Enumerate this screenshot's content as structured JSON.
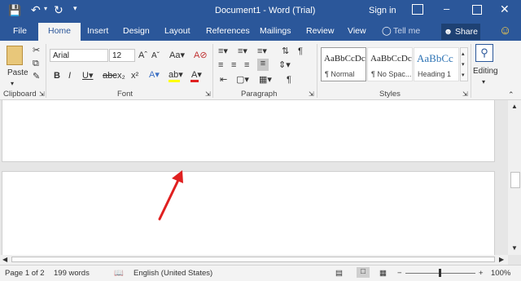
{
  "titlebar": {
    "document_title": "Document1  -  Word (Trial)",
    "signin_label": "Sign in",
    "save_icon": "save-icon",
    "undo_icon": "undo-icon",
    "redo_icon": "redo-icon"
  },
  "ribbon_tabs": [
    "File",
    "Home",
    "Insert",
    "Design",
    "Layout",
    "References",
    "Mailings",
    "Review",
    "View"
  ],
  "tell_me": "Tell me",
  "share_label": "Share",
  "clipboard": {
    "paste_label": "Paste",
    "group_label": "Clipboard"
  },
  "font": {
    "name": "Arial",
    "size": "12",
    "group_label": "Font"
  },
  "paragraph": {
    "group_label": "Paragraph"
  },
  "styles": {
    "group_label": "Styles",
    "items": [
      {
        "preview": "AaBbCcDc",
        "name": "¶ Normal"
      },
      {
        "preview": "AaBbCcDc",
        "name": "¶ No Spac..."
      },
      {
        "preview": "AaBbCc",
        "name": "Heading 1"
      }
    ]
  },
  "editing": {
    "label": "Editing"
  },
  "status": {
    "page": "Page 1 of 2",
    "words": "199 words",
    "language": "English (United States)",
    "zoom": "100%"
  },
  "colors": {
    "title_bar": "#2b579a",
    "accent": "#2b579a",
    "arrow": "#e02020",
    "highlight": "#ffff00",
    "font_color": "#e02020"
  }
}
